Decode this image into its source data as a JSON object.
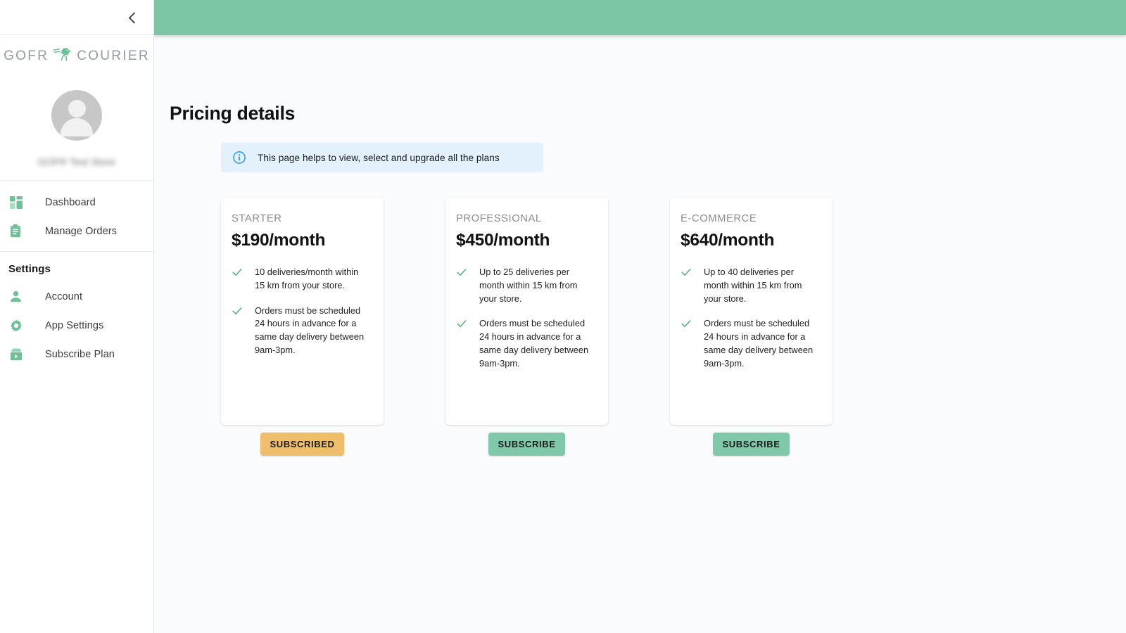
{
  "brand": {
    "name_left": "GOFR",
    "name_right": "COURIER",
    "logo_icon": "running-dinosaur-icon",
    "logo_color": "#6ec197"
  },
  "theme": {
    "header_green": "#7cc6a6",
    "accent_green": "#7fc8a9",
    "accent_amber": "#efbe6b",
    "info_blue": "#2196f3",
    "info_bg": "#e2f1fb",
    "page_bg": "#fafbfc"
  },
  "sidebar": {
    "collapse_icon": "chevron-left-icon",
    "profile": {
      "avatar_icon": "user-avatar-icon",
      "store_name": "GOFR Test Store"
    },
    "nav": [
      {
        "label": "Dashboard",
        "icon": "dashboard-grid-icon"
      },
      {
        "label": "Manage Orders",
        "icon": "clipboard-icon"
      }
    ],
    "settings_heading": "Settings",
    "settings_items": [
      {
        "label": "Account",
        "icon": "person-icon"
      },
      {
        "label": "App Settings",
        "icon": "gear-icon"
      },
      {
        "label": "Subscribe Plan",
        "icon": "subscription-icon"
      }
    ]
  },
  "main": {
    "page_title": "Pricing details",
    "info_banner": {
      "icon": "info-circle-icon",
      "text": "This page helps to view, select and upgrade all the plans"
    },
    "plans": [
      {
        "name": "STARTER",
        "price": "$190/month",
        "features": [
          "10 deliveries/month within 15 km from your store.",
          "Orders must be scheduled 24 hours in advance for a same day delivery between 9am-3pm."
        ],
        "button_label": "SUBSCRIBED",
        "button_state": "subscribed"
      },
      {
        "name": "PROFESSIONAL",
        "price": "$450/month",
        "features": [
          "Up to 25 deliveries per month within 15 km from your store.",
          "Orders must be scheduled 24 hours in advance for a same day delivery between 9am-3pm."
        ],
        "button_label": "SUBSCRIBE",
        "button_state": "subscribe"
      },
      {
        "name": "E-COMMERCE",
        "price": "$640/month",
        "features": [
          "Up to 40 deliveries per month within 15 km from your store.",
          "Orders must be scheduled 24 hours in advance for a same day delivery between 9am-3pm."
        ],
        "button_label": "SUBSCRIBE",
        "button_state": "subscribe"
      }
    ]
  }
}
